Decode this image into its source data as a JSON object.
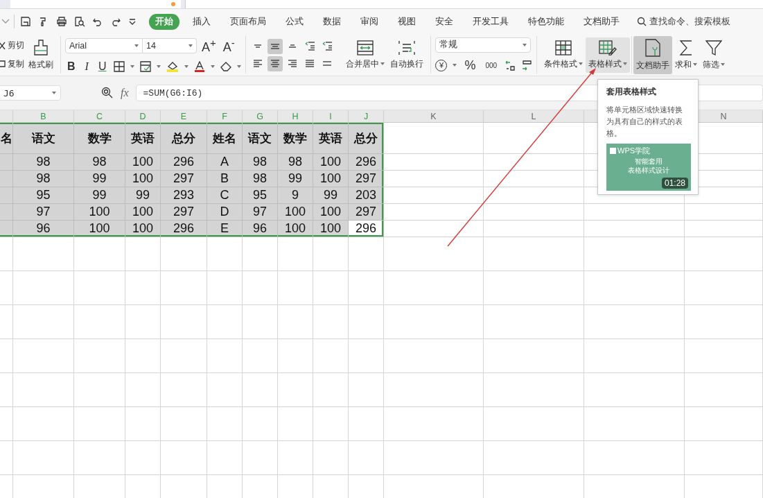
{
  "menu": {
    "tabs": [
      {
        "label": "开始",
        "selected": true
      },
      {
        "label": "插入",
        "selected": false
      },
      {
        "label": "页面布局",
        "selected": false
      },
      {
        "label": "公式",
        "selected": false
      },
      {
        "label": "数据",
        "selected": false
      },
      {
        "label": "审阅",
        "selected": false
      },
      {
        "label": "视图",
        "selected": false
      },
      {
        "label": "安全",
        "selected": false
      },
      {
        "label": "开发工具",
        "selected": false
      },
      {
        "label": "特色功能",
        "selected": false
      },
      {
        "label": "文档助手",
        "selected": false
      }
    ],
    "search": {
      "placeholder": "查找命令、搜索模板"
    }
  },
  "ribbon": {
    "clipboard": {
      "cut": "剪切",
      "copy": "复制",
      "painter": "格式刷"
    },
    "font": {
      "family": "Arial",
      "size": "14",
      "grow": "A$^{+}$",
      "shrink": "A$^{-}$",
      "bold": "B",
      "italic": "I",
      "underline": "U"
    },
    "align_buttons": [
      {
        "kind": "top",
        "pressed": false
      },
      {
        "kind": "middle",
        "pressed": true
      },
      {
        "kind": "bottom",
        "pressed": false
      },
      {
        "kind": "outdent",
        "pressed": false
      },
      {
        "kind": "indent",
        "pressed": false
      },
      {
        "kind": "left",
        "pressed": false
      },
      {
        "kind": "center",
        "pressed": true
      },
      {
        "kind": "right",
        "pressed": false
      },
      {
        "kind": "justify",
        "pressed": false
      },
      {
        "kind": "distribute",
        "pressed": false
      }
    ],
    "merge": "合并居中",
    "wrap": "自动换行",
    "number": {
      "format": "常规",
      "currency": "¥",
      "percent": "%",
      "thousands": "000"
    },
    "large_buttons": [
      {
        "kind": "conditional",
        "label": "条件格式",
        "hovered": false,
        "pressed": false,
        "caret": true
      },
      {
        "kind": "table_style",
        "label": "表格样式",
        "hovered": true,
        "pressed": false,
        "caret": true
      },
      {
        "kind": "assistant",
        "label": "文档助手",
        "hovered": false,
        "pressed": true,
        "caret": false
      },
      {
        "kind": "sum",
        "label": "求和",
        "hovered": false,
        "pressed": false,
        "caret": true
      },
      {
        "kind": "filter",
        "label": "筛选",
        "hovered": false,
        "pressed": false,
        "caret": true
      }
    ]
  },
  "formula_bar": {
    "name_box": "J6",
    "fx_label": "fx",
    "formula": "=SUM(G6:I6)"
  },
  "sheet": {
    "columns": [
      {
        "letter": "B",
        "selected": true
      },
      {
        "letter": "C",
        "selected": true
      },
      {
        "letter": "D",
        "selected": true
      },
      {
        "letter": "E",
        "selected": true
      },
      {
        "letter": "F",
        "selected": true
      },
      {
        "letter": "G",
        "selected": true
      },
      {
        "letter": "H",
        "selected": true
      },
      {
        "letter": "I",
        "selected": true
      },
      {
        "letter": "J",
        "selected": true
      },
      {
        "letter": "K",
        "selected": false
      },
      {
        "letter": "L",
        "selected": false
      },
      {
        "letter": "N",
        "selected": false
      }
    ],
    "header_row": {
      "cut_cell": "名",
      "cells": [
        "语文",
        "数学",
        "英语",
        "总分",
        "姓名",
        "语文",
        "数学",
        "英语",
        "总分"
      ]
    },
    "rows": [
      {
        "cells": [
          {
            "text": "98",
            "active": false
          },
          {
            "text": "98",
            "active": false
          },
          {
            "text": "100",
            "active": false
          },
          {
            "text": "296",
            "active": false
          },
          {
            "text": "A",
            "active": false
          },
          {
            "text": "98",
            "active": false
          },
          {
            "text": "98",
            "active": false
          },
          {
            "text": "100",
            "active": false
          },
          {
            "text": "296",
            "active": false
          }
        ]
      },
      {
        "cells": [
          {
            "text": "98",
            "active": false
          },
          {
            "text": "99",
            "active": false
          },
          {
            "text": "100",
            "active": false
          },
          {
            "text": "297",
            "active": false
          },
          {
            "text": "B",
            "active": false
          },
          {
            "text": "98",
            "active": false
          },
          {
            "text": "99",
            "active": false
          },
          {
            "text": "100",
            "active": false
          },
          {
            "text": "297",
            "active": false
          }
        ]
      },
      {
        "cells": [
          {
            "text": "95",
            "active": false
          },
          {
            "text": "99",
            "active": false
          },
          {
            "text": "99",
            "active": false
          },
          {
            "text": "293",
            "active": false
          },
          {
            "text": "C",
            "active": false
          },
          {
            "text": "95",
            "active": false
          },
          {
            "text": "9",
            "active": false
          },
          {
            "text": "99",
            "active": false
          },
          {
            "text": "203",
            "active": false
          }
        ]
      },
      {
        "cells": [
          {
            "text": "97",
            "active": false
          },
          {
            "text": "100",
            "active": false
          },
          {
            "text": "100",
            "active": false
          },
          {
            "text": "297",
            "active": false
          },
          {
            "text": "D",
            "active": false
          },
          {
            "text": "97",
            "active": false
          },
          {
            "text": "100",
            "active": false
          },
          {
            "text": "100",
            "active": false
          },
          {
            "text": "297",
            "active": false
          }
        ]
      },
      {
        "cells": [
          {
            "text": "96",
            "active": false
          },
          {
            "text": "100",
            "active": false
          },
          {
            "text": "100",
            "active": false
          },
          {
            "text": "296",
            "active": false
          },
          {
            "text": "E",
            "active": false
          },
          {
            "text": "96",
            "active": false
          },
          {
            "text": "100",
            "active": false
          },
          {
            "text": "100",
            "active": false
          },
          {
            "text": "296",
            "active": true
          }
        ]
      }
    ]
  },
  "tooltip": {
    "title": "套用表格样式",
    "body": "将单元格区域快速转换为具有自己的样式的表格。",
    "video": {
      "brand": "WPS学院",
      "title_lines": [
        "智能套用",
        "表格样式设计"
      ],
      "duration": "01:28"
    }
  }
}
